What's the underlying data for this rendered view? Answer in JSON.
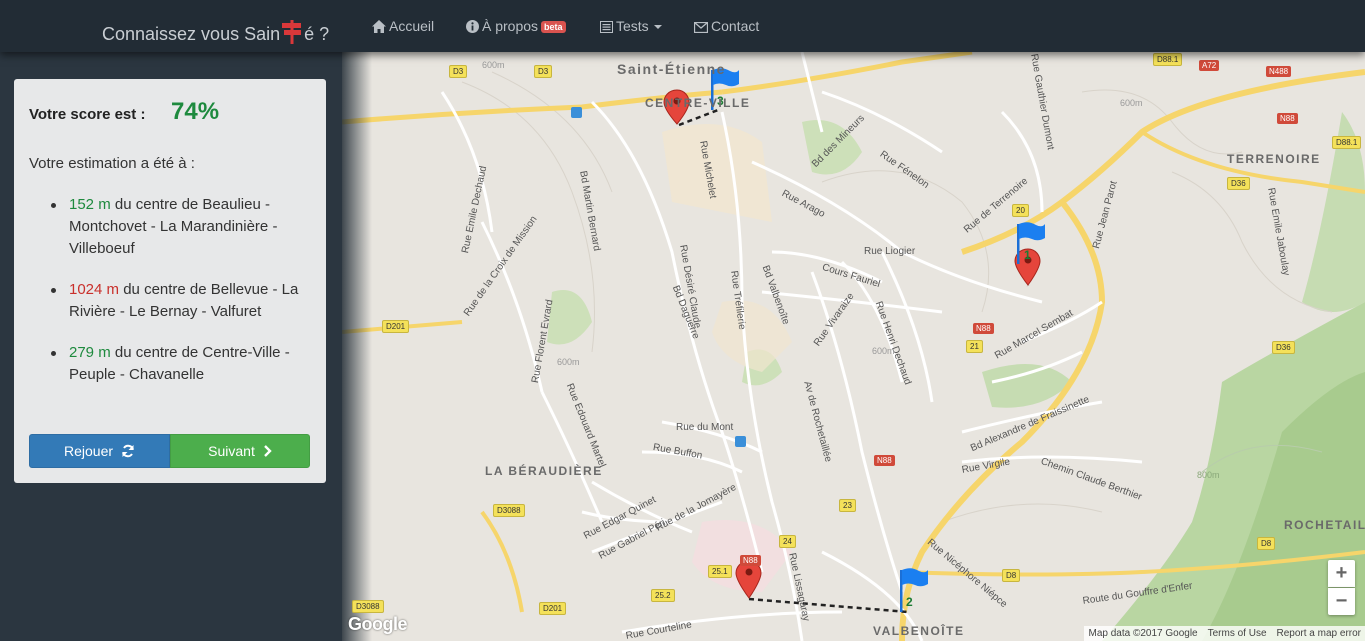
{
  "nav": {
    "brand_before": "Connaissez vous Sain",
    "brand_after": "é ?",
    "items": [
      {
        "label": "Accueil",
        "icon": "home-icon"
      },
      {
        "label": "À propos",
        "icon": "info-icon",
        "badge": "beta"
      },
      {
        "label": "Tests",
        "icon": "list-icon"
      },
      {
        "label": "Contact",
        "icon": "envelope-icon"
      }
    ]
  },
  "panel": {
    "score_label": "Votre score est :",
    "score_value": "74%",
    "estimation_label": "Votre estimation a été à :",
    "results": [
      {
        "distance": "152 m",
        "status": "good",
        "text": " du centre de Beaulieu - Montchovet - La Marandinière - Villeboeuf"
      },
      {
        "distance": "1024 m",
        "status": "bad",
        "text": " du centre de Bellevue - La Rivière - Le Bernay - Valfuret"
      },
      {
        "distance": "279 m",
        "status": "good",
        "text": " du centre de Centre-Ville - Peuple - Chavanelle"
      }
    ],
    "replay_label": "Rejouer",
    "next_label": "Suivant"
  },
  "map": {
    "places": {
      "saint_etienne": "Saint-Étienne",
      "centre_ville": "CENTRE-VILLE",
      "terrenoire": "TERRENOIRE",
      "beraudiere": "LA BÉRAUDIÈRE",
      "valbenoite": "VALBENOÎTE",
      "rochetaillee": "ROCHETAILLÉE"
    },
    "streets": {
      "emile_dechaud": "Rue Emile Dechaud",
      "croix_mission": "Rue de la Croix de Mission",
      "martin_bernard": "Bd Martin Bernard",
      "michelet": "Rue Michelet",
      "desire_claude": "Rue Désiré Claude",
      "daguerre": "Bd Daguerre",
      "trefilerie": "Rue Tréfilerie",
      "valbenoite": "Bd Valbenoîte",
      "arago": "Rue Arago",
      "liogier": "Rue Liogier",
      "fauriel": "Cours Fauriel",
      "vivaraize": "Rue Vivaraize",
      "henri_dechaud": "Rue Henri Dechaud",
      "rochetaillee_av": "Av de Rochetaillée",
      "mineurs": "Bd des Mineurs",
      "fenelon": "Rue Fénelon",
      "terrenoire_rue": "Rue de Terrenoire",
      "marcel_sembat": "Rue Marcel Sembat",
      "fraissinette": "Bd Alexandre de Fraissinette",
      "virgile": "Rue Virgile",
      "berthier": "Chemin Claude Berthier",
      "florent_evrard": "Rue Florent Evrard",
      "edouard_martel": "Rue Edouard Martel",
      "du_mont": "Rue du Mont",
      "buffon": "Rue Buffon",
      "edgar_quinet": "Rue Edgar Quinet",
      "jomayere": "Rue de la Jomayère",
      "gabriel_peri": "Rue Gabriel Péri",
      "nicephore": "Rue Nicéphore Niépce",
      "gouffre": "Route du Gouffre d'Enfer",
      "courteline": "Rue Courteline",
      "gauthier": "Rue Gauthier Dumont",
      "jean_parot": "Rue Jean Parot",
      "emile_jaboulay": "Rue Emile Jaboulay",
      "lissagaray": "Rue Lissagaray"
    },
    "shields": {
      "d3a": "D3",
      "d3b": "D3",
      "d881": "D88.1",
      "a72": "A72",
      "n488": "N488",
      "n88a": "N88",
      "d881b": "D88.1",
      "d36a": "D36",
      "n20": "20",
      "d201a": "D201",
      "n88b": "N88",
      "n21": "21",
      "d36b": "D36",
      "n88c": "N88",
      "d3088a": "D3088",
      "n23": "23",
      "n24": "24",
      "n251": "25.1",
      "n252": "25.2",
      "d201b": "D201",
      "d3088b": "D3088",
      "d8a": "D8",
      "d8b": "D8",
      "n22": "N88"
    },
    "contours": {
      "c1": "600m",
      "c2": "600m",
      "c3": "600m",
      "c4": "800m",
      "c5": "600m"
    },
    "flag_numbers": [
      "3",
      "1",
      "2"
    ],
    "zoom_in": "+",
    "zoom_out": "−",
    "google": "Google",
    "attribution": [
      "Map data ©2017 Google",
      "Terms of Use",
      "Report a map error"
    ]
  }
}
